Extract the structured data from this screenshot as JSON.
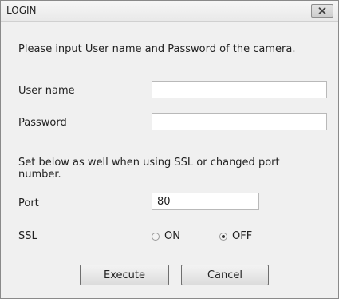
{
  "window": {
    "title": "LOGIN",
    "close_icon": "close-icon"
  },
  "form": {
    "instruction": "Please input User name and Password of the camera.",
    "username_label": "User name",
    "username_value": "",
    "password_label": "Password",
    "password_value": "",
    "ssl_note": "Set below as well when using SSL or changed port number.",
    "port_label": "Port",
    "port_value": "80",
    "ssl_label": "SSL",
    "ssl_on_label": "ON",
    "ssl_off_label": "OFF",
    "ssl_selected": "OFF"
  },
  "buttons": {
    "execute_label": "Execute",
    "cancel_label": "Cancel"
  }
}
